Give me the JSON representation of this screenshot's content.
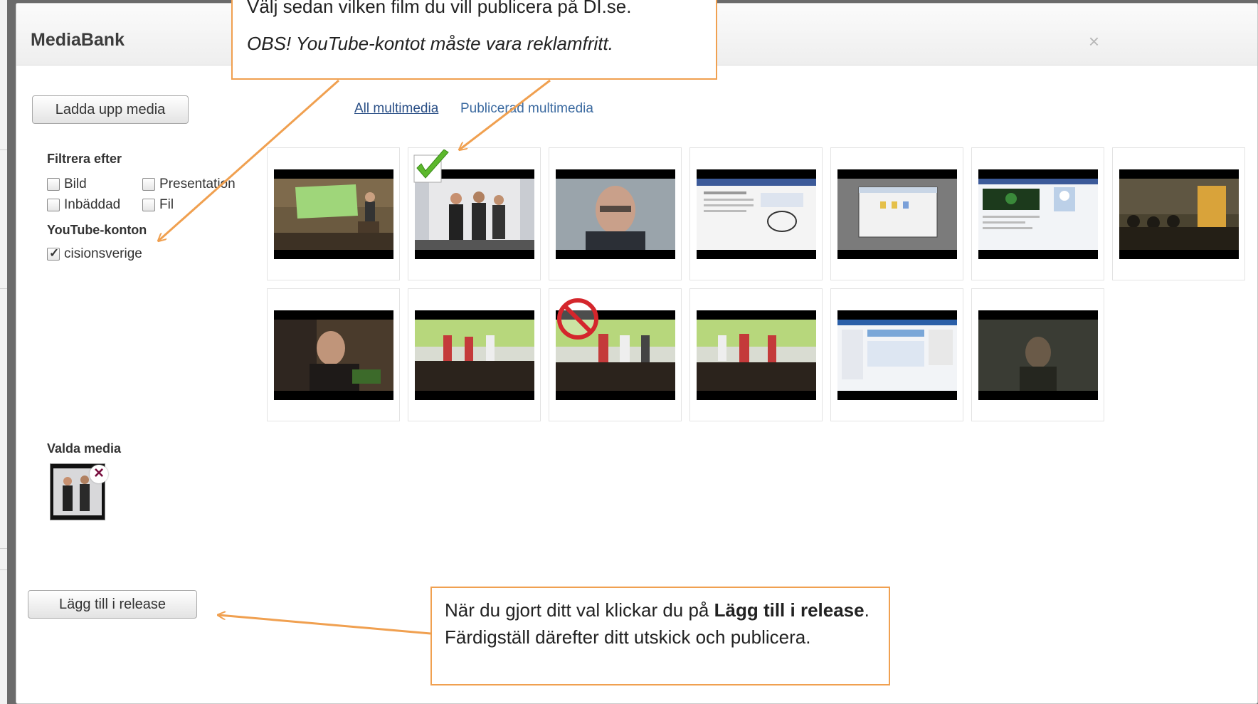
{
  "modal": {
    "title": "MediaBank",
    "close_label": "×"
  },
  "toolbar": {
    "upload_label": "Ladda upp media"
  },
  "tabs": [
    {
      "label": "All multimedia"
    },
    {
      "label": "Publicerad multimedia"
    }
  ],
  "filters": {
    "heading": "Filtrera efter",
    "options": [
      {
        "label": "Bild",
        "checked": false
      },
      {
        "label": "Presentation",
        "checked": false
      },
      {
        "label": "Inbäddad",
        "checked": false
      },
      {
        "label": "Fil",
        "checked": false
      }
    ]
  },
  "youtube": {
    "heading": "YouTube-konton",
    "accounts": [
      {
        "label": "cisionsverige",
        "checked": true
      }
    ]
  },
  "media_grid": {
    "row1": [
      "video-1",
      "video-2",
      "video-3",
      "video-4",
      "video-5",
      "video-6",
      "video-7"
    ],
    "row2": [
      "video-8",
      "video-9",
      "video-10",
      "video-11",
      "video-12",
      "video-13"
    ],
    "selected_index": 1,
    "blocked_index": 9
  },
  "selected_media": {
    "heading": "Valda media",
    "remove_label": "×"
  },
  "footer": {
    "add_label": "Lägg till i release"
  },
  "annotations": {
    "top_line1": "Välj sedan vilken film du vill publicera på DI.se.",
    "top_line2": "OBS! YouTube-kontot måste vara reklamfritt.",
    "bottom_pre": "När du gjort ditt val klickar du på ",
    "bottom_bold1": "Lägg till i release",
    "bottom_post": ". Färdigställ därefter ditt utskick och publicera.",
    "accent_color": "#f0a050"
  }
}
